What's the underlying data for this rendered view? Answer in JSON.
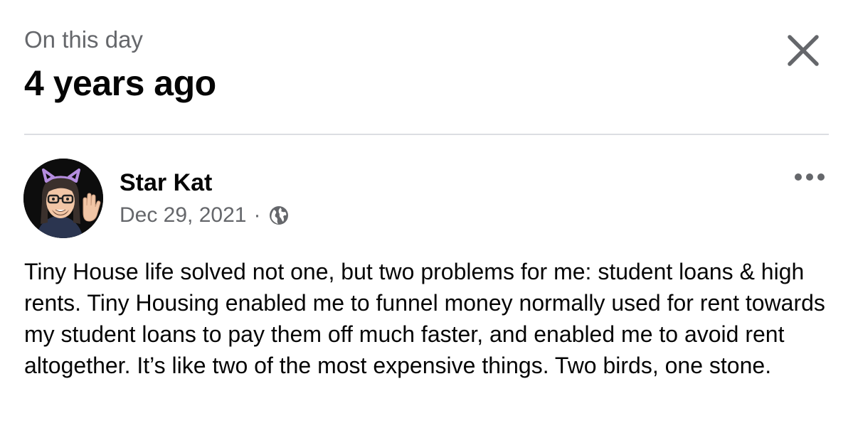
{
  "header": {
    "subtitle": "On this day",
    "title": "4 years ago"
  },
  "icons": {
    "close": "close-icon",
    "more": "more-options-icon",
    "audience": "globe-icon",
    "avatar": "cartoon-avatar-cat-ears"
  },
  "post": {
    "author": "Star Kat",
    "date": "Dec 29, 2021",
    "separator": "·",
    "text": "Tiny House life solved not one, but two problems for me: student loans & high rents. Tiny Housing enabled me to funnel money normally used for rent towards my student loans to pay them off much faster, and enabled me to avoid rent altogether. It’s like two of the most expensive things. Two birds, one stone."
  },
  "colors": {
    "primary_text": "#050505",
    "secondary_text": "#65676b",
    "divider": "#dcdee2",
    "avatar_ears": "#b58de0"
  }
}
